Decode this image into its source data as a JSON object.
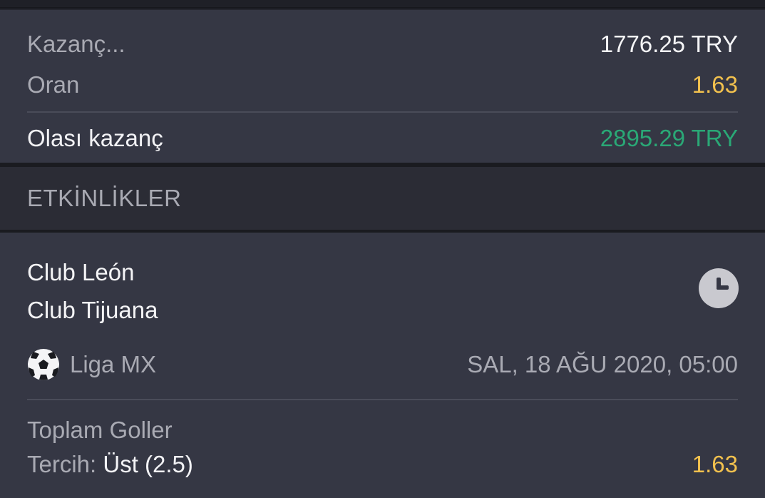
{
  "summary": {
    "stake_label": "Kazanç...",
    "stake_value": "1776.25 TRY",
    "odds_label": "Oran",
    "odds_value": "1.63",
    "potential_label": "Olası kazanç",
    "potential_value": "2895.29 TRY"
  },
  "section": {
    "title": "ETKİNLİKLER"
  },
  "event": {
    "home_team": "Club León",
    "away_team": "Club Tijuana",
    "status_icon": "clock-icon",
    "sport_icon": "soccer-ball-icon",
    "league": "Liga MX",
    "datetime": "SAL, 18 AĞU 2020, 05:00",
    "market": "Toplam Goller",
    "selection_label": "Tercih: ",
    "selection_value": "Üst (2.5)",
    "selection_odds": "1.63"
  },
  "colors": {
    "background": "#25262e",
    "panel": "#353744",
    "header": "#2b2c35",
    "odds_yellow": "#f2c14e",
    "win_green": "#2aa876",
    "muted_text": "#a9aab3"
  }
}
